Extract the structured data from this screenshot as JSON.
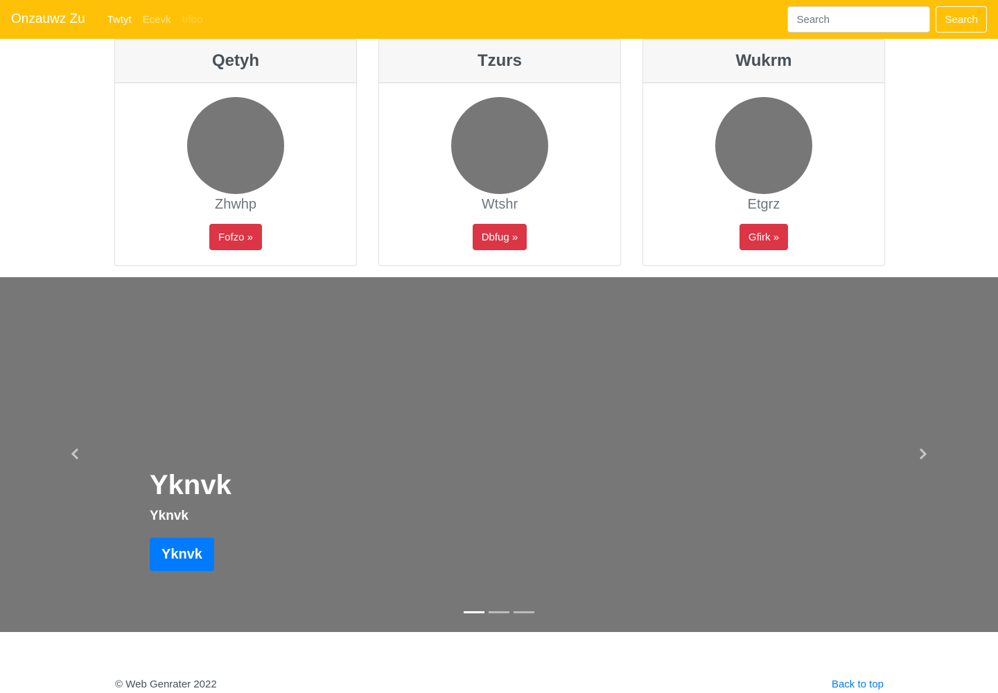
{
  "navbar": {
    "brand": "Onzauwz Zu",
    "links": [
      {
        "label": "Twtyt"
      },
      {
        "label": "Ecevk"
      },
      {
        "label": "Irfoo"
      }
    ],
    "search_placeholder": "Search",
    "search_button": "Search",
    "color": "#ffc107"
  },
  "cards": [
    {
      "title": "Qetyh",
      "subtitle": "Zhwhp",
      "button": "Fofzo »"
    },
    {
      "title": "Tzurs",
      "subtitle": "Wtshr",
      "button": "Dbfug »"
    },
    {
      "title": "Wukrm",
      "subtitle": "Etgrz",
      "button": "Gfirk »"
    }
  ],
  "carousel": {
    "title": "Yknvk",
    "text": "Yknvk",
    "button": "Yknvk",
    "prev_icon": "chevron-left-icon",
    "next_icon": "chevron-right-icon",
    "slide_count": 3,
    "active_slide": 1
  },
  "footer": {
    "copyright": "© Web Genrater 2022",
    "back_to_top": "Back to top"
  }
}
